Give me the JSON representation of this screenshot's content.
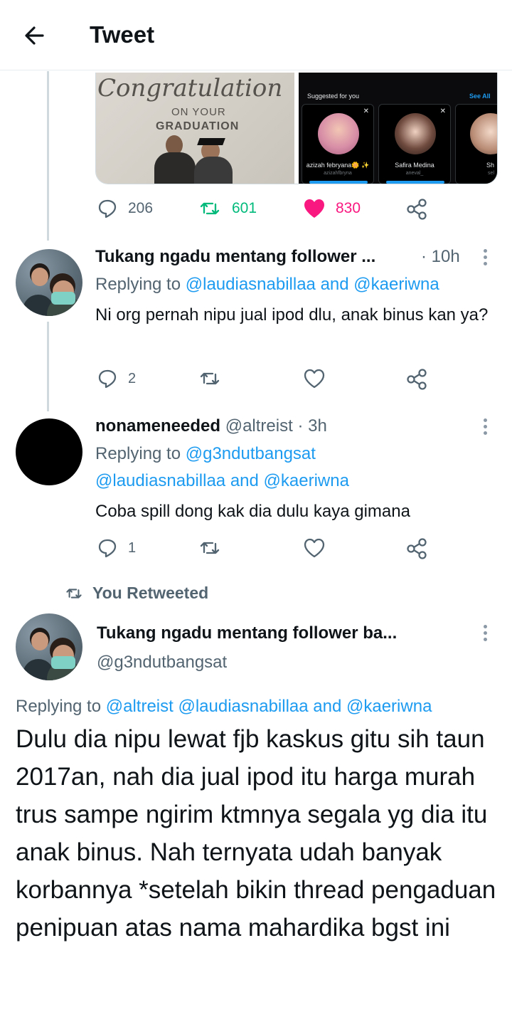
{
  "header": {
    "title": "Tweet"
  },
  "media": {
    "left_image": {
      "line1": "Congratulation",
      "line2": "ON YOUR",
      "line3": "GRADUATION"
    },
    "right_image": {
      "suggested_label": "Suggested for you",
      "see_all": "See All",
      "cards": [
        {
          "name": "azizah febryana🌼 ✨",
          "handle": "azizahfbryna"
        },
        {
          "name": "Safira Medina",
          "handle": "aneval_"
        },
        {
          "name": "Sh",
          "handle": "sel"
        }
      ]
    }
  },
  "main_tweet_actions": {
    "replies": "206",
    "retweets": "601",
    "likes": "830"
  },
  "replies": [
    {
      "name": "Tukang ngadu mentang follower ...",
      "time": "· 10h",
      "replying_prefix": "Replying to",
      "replying_to": "@laudiasnabillaa and @kaeriwna",
      "text": "Ni org pernah nipu jual ipod dlu, anak binus kan ya?",
      "reply_count": "2"
    },
    {
      "name": "nonameneeded",
      "handle": "@altreist",
      "time": "· 3h",
      "replying_prefix": "Replying to",
      "replying_to_line1": "@g3ndutbangsat",
      "replying_to_line2": "@laudiasnabillaa and @kaeriwna",
      "text": "Coba spill dong kak dia dulu kaya gimana",
      "reply_count": "1"
    }
  ],
  "retweet_banner": "You Retweeted",
  "focused_tweet": {
    "name": "Tukang ngadu mentang follower ba...",
    "handle": "@g3ndutbangsat",
    "replying_prefix": "Replying to",
    "replying_to": "@altreist @laudiasnabillaa and @kaeriwna",
    "text": "Dulu dia nipu lewat fjb kaskus gitu sih taun 2017an, nah dia jual ipod itu harga murah trus sampe ngirim ktmnya segala yg dia itu anak binus. Nah ternyata udah banyak korbannya *setelah bikin thread pengaduan penipuan atas nama mahardika bgst ini"
  },
  "colors": {
    "accent": "#1d9bf0",
    "retweet": "#00ba7c",
    "like": "#f91880",
    "muted": "#536471"
  }
}
